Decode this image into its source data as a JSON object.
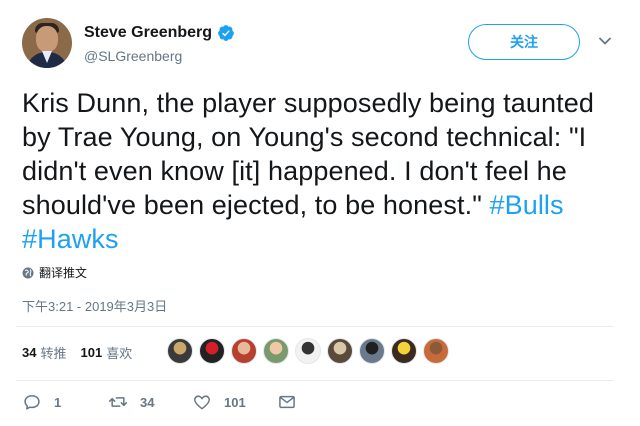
{
  "author": {
    "display_name": "Steve Greenberg",
    "handle": "@SLGreenberg",
    "verified": true
  },
  "follow_button_label": "关注",
  "tweet": {
    "text": "Kris Dunn, the player supposedly being taunted by Trae Young, on Young's second technical: \"I didn't even know [it] happened. I don't feel he should've been ejected, to be honest.\" ",
    "hashtags": [
      "#Bulls",
      "#Hawks"
    ]
  },
  "translate_label": "翻译推文",
  "timestamp": "下午3:21 - 2019年3月3日",
  "stats": {
    "retweets_count": "34",
    "retweets_label": "转推",
    "likes_count": "101",
    "likes_label": "喜欢"
  },
  "likers": [
    {
      "color": "#3a3a3a",
      "accent": "#c9a86a"
    },
    {
      "color": "#222222",
      "accent": "#d21f2a"
    },
    {
      "color": "#b8402e",
      "accent": "#e8b89a"
    },
    {
      "color": "#7a9a6e",
      "accent": "#f0c8a8"
    },
    {
      "color": "#f2f2f2",
      "accent": "#333333"
    },
    {
      "color": "#5a4a3a",
      "accent": "#d8c8a8"
    },
    {
      "color": "#6a7a8a",
      "accent": "#202020"
    },
    {
      "color": "#3b2a20",
      "accent": "#f4d23a"
    },
    {
      "color": "#c86a3a",
      "accent": "#8a5a3a"
    }
  ],
  "actions": {
    "reply_count": "1",
    "retweet_count": "34",
    "like_count": "101"
  },
  "colors": {
    "accent": "#1da1f2",
    "secondary_text": "#657786",
    "primary_text": "#14171a"
  }
}
